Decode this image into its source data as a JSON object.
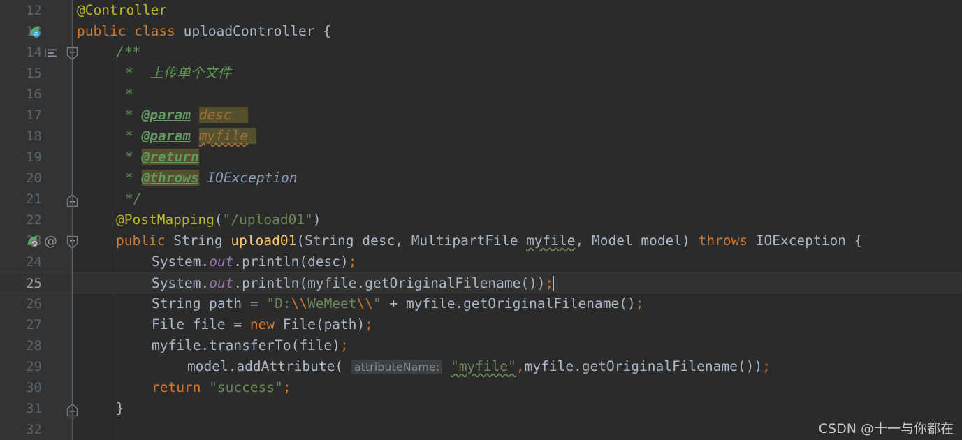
{
  "editor": {
    "theme": "Darcula",
    "language": "Java",
    "current_line": 25,
    "colors": {
      "background": "#2b2b2b",
      "gutter_background": "#313335",
      "current_line_background": "#323232",
      "default_text": "#a9b7c6",
      "keyword": "#cc7832",
      "annotation": "#bbb529",
      "string": "#6a8759",
      "comment": "#629755",
      "method_declaration": "#ffc66d",
      "static_field": "#9876aa",
      "line_number": "#606366",
      "current_line_number": "#a4a3a3",
      "javadoc_tag": "#5f9b5f",
      "javadoc_param": "#a1713b",
      "javadoc_highlight": "#55512e",
      "parameter_hint": "#868a91"
    },
    "lines": [
      {
        "num": "12",
        "gutter_icons": [],
        "fold": "none"
      },
      {
        "num": "13",
        "gutter_icons": [
          "spring-bean-icon"
        ],
        "fold": "none"
      },
      {
        "num": "14",
        "gutter_icons": [
          "structure-lines-icon"
        ],
        "fold": "fold-start"
      },
      {
        "num": "15",
        "gutter_icons": [],
        "fold": "none"
      },
      {
        "num": "16",
        "gutter_icons": [],
        "fold": "none"
      },
      {
        "num": "17",
        "gutter_icons": [],
        "fold": "none"
      },
      {
        "num": "18",
        "gutter_icons": [],
        "fold": "none"
      },
      {
        "num": "19",
        "gutter_icons": [],
        "fold": "none"
      },
      {
        "num": "20",
        "gutter_icons": [],
        "fold": "none"
      },
      {
        "num": "21",
        "gutter_icons": [],
        "fold": "fold-end"
      },
      {
        "num": "22",
        "gutter_icons": [],
        "fold": "none"
      },
      {
        "num": "23",
        "gutter_icons": [
          "spring-request-mapping-icon",
          "override-at-icon"
        ],
        "fold": "fold-start"
      },
      {
        "num": "24",
        "gutter_icons": [],
        "fold": "none"
      },
      {
        "num": "25",
        "gutter_icons": [],
        "fold": "none"
      },
      {
        "num": "26",
        "gutter_icons": [],
        "fold": "none"
      },
      {
        "num": "27",
        "gutter_icons": [],
        "fold": "none"
      },
      {
        "num": "28",
        "gutter_icons": [],
        "fold": "none"
      },
      {
        "num": "29",
        "gutter_icons": [],
        "fold": "none"
      },
      {
        "num": "30",
        "gutter_icons": [],
        "fold": "none"
      },
      {
        "num": "31",
        "gutter_icons": [],
        "fold": "fold-end"
      },
      {
        "num": "32",
        "gutter_icons": [],
        "fold": "none"
      }
    ],
    "code_text": {
      "l12_annotation": "@Controller",
      "l13_public": "public",
      "l13_class": "class",
      "l13_name": "uploadController",
      "l13_brace": "{",
      "l14_javadoc_open": "/**",
      "l15_star": "*",
      "l15_text": "上传单个文件",
      "l16_star": "*",
      "l17_star": "*",
      "l17_tag": "@param",
      "l17_name": "desc",
      "l18_star": "*",
      "l18_tag": "@param",
      "l18_name": "myfile",
      "l19_star": "*",
      "l19_tag": "@return",
      "l20_star": "*",
      "l20_tag": "@throws",
      "l20_type": "IOException",
      "l21_javadoc_close": "*/",
      "l22_annotation": "@PostMapping",
      "l22_open": "(",
      "l22_path": "\"/upload01\"",
      "l22_close": ")",
      "l23_public": "public",
      "l23_ret": "String",
      "l23_method": "upload01",
      "l23_sig_a": "(String desc, MultipartFile ",
      "l23_param": "myfile",
      "l23_sig_b": ", Model model) ",
      "l23_throws": "throws",
      "l23_exc": " IOException {",
      "l24_sys": "System.",
      "l24_out": "out",
      "l24_rest": ".println(desc)",
      "l24_semi": ";",
      "l25_sys": "System.",
      "l25_out": "out",
      "l25_rest": ".println(myfile.getOriginalFilename())",
      "l25_semi": ";",
      "l26_decl": "String path = ",
      "l26_q1": "\"D:",
      "l26_e1": "\\\\",
      "l26_s1": "WeMeet",
      "l26_e2": "\\\\",
      "l26_q2": "\"",
      "l26_plus": " + myfile.getOriginalFilename()",
      "l26_semi": ";",
      "l27_a": "File file = ",
      "l27_new": "new",
      "l27_b": " File(path)",
      "l27_semi": ";",
      "l28_a": "myfile.transferTo(file)",
      "l28_semi": ";",
      "l29_a": "model.addAttribute( ",
      "l29_hint": "attributeName:",
      "l29_str": "\"myfile\"",
      "l29_comma": ",",
      "l29_b": "myfile.getOriginalFilename())",
      "l29_semi": ";",
      "l30_return": "return",
      "l30_str": " \"success\"",
      "l30_semi": ";",
      "l31_brace": "}"
    }
  },
  "watermark": {
    "text": "CSDN @十一与你都在"
  }
}
